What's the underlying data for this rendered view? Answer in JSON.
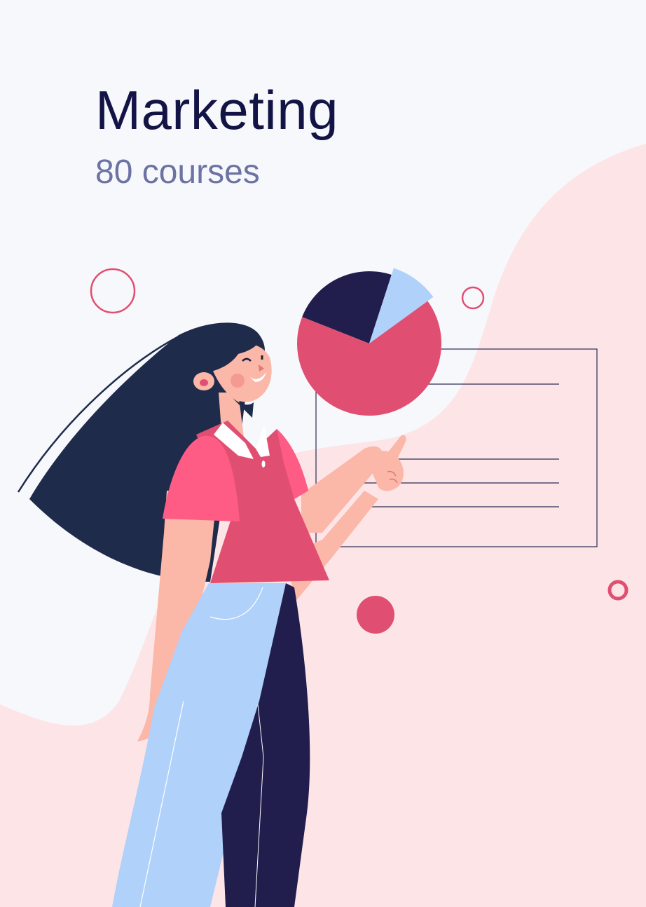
{
  "card": {
    "title": "Marketing",
    "subtitle": "80 courses"
  },
  "colors": {
    "background": "#f7f8fc",
    "blob": "#fde5e7",
    "title": "#131445",
    "subtitle": "#6c72a3",
    "accent_pink": "#e04f72",
    "navy": "#211e4d",
    "light_blue": "#afd1fa",
    "skin": "#fbb7a8",
    "hair": "#1f2b4b",
    "shirt": "#fe5c85"
  },
  "chart_data": {
    "type": "pie",
    "title": "",
    "slices": [
      {
        "color": "#e04f72",
        "value": 66
      },
      {
        "color": "#211e4d",
        "value": 24
      },
      {
        "color": "#afd1fa",
        "value": 10
      }
    ],
    "legend": false
  },
  "icons": [
    "pie-chart-icon",
    "document-board-icon",
    "ring-icon",
    "dot-icon"
  ]
}
